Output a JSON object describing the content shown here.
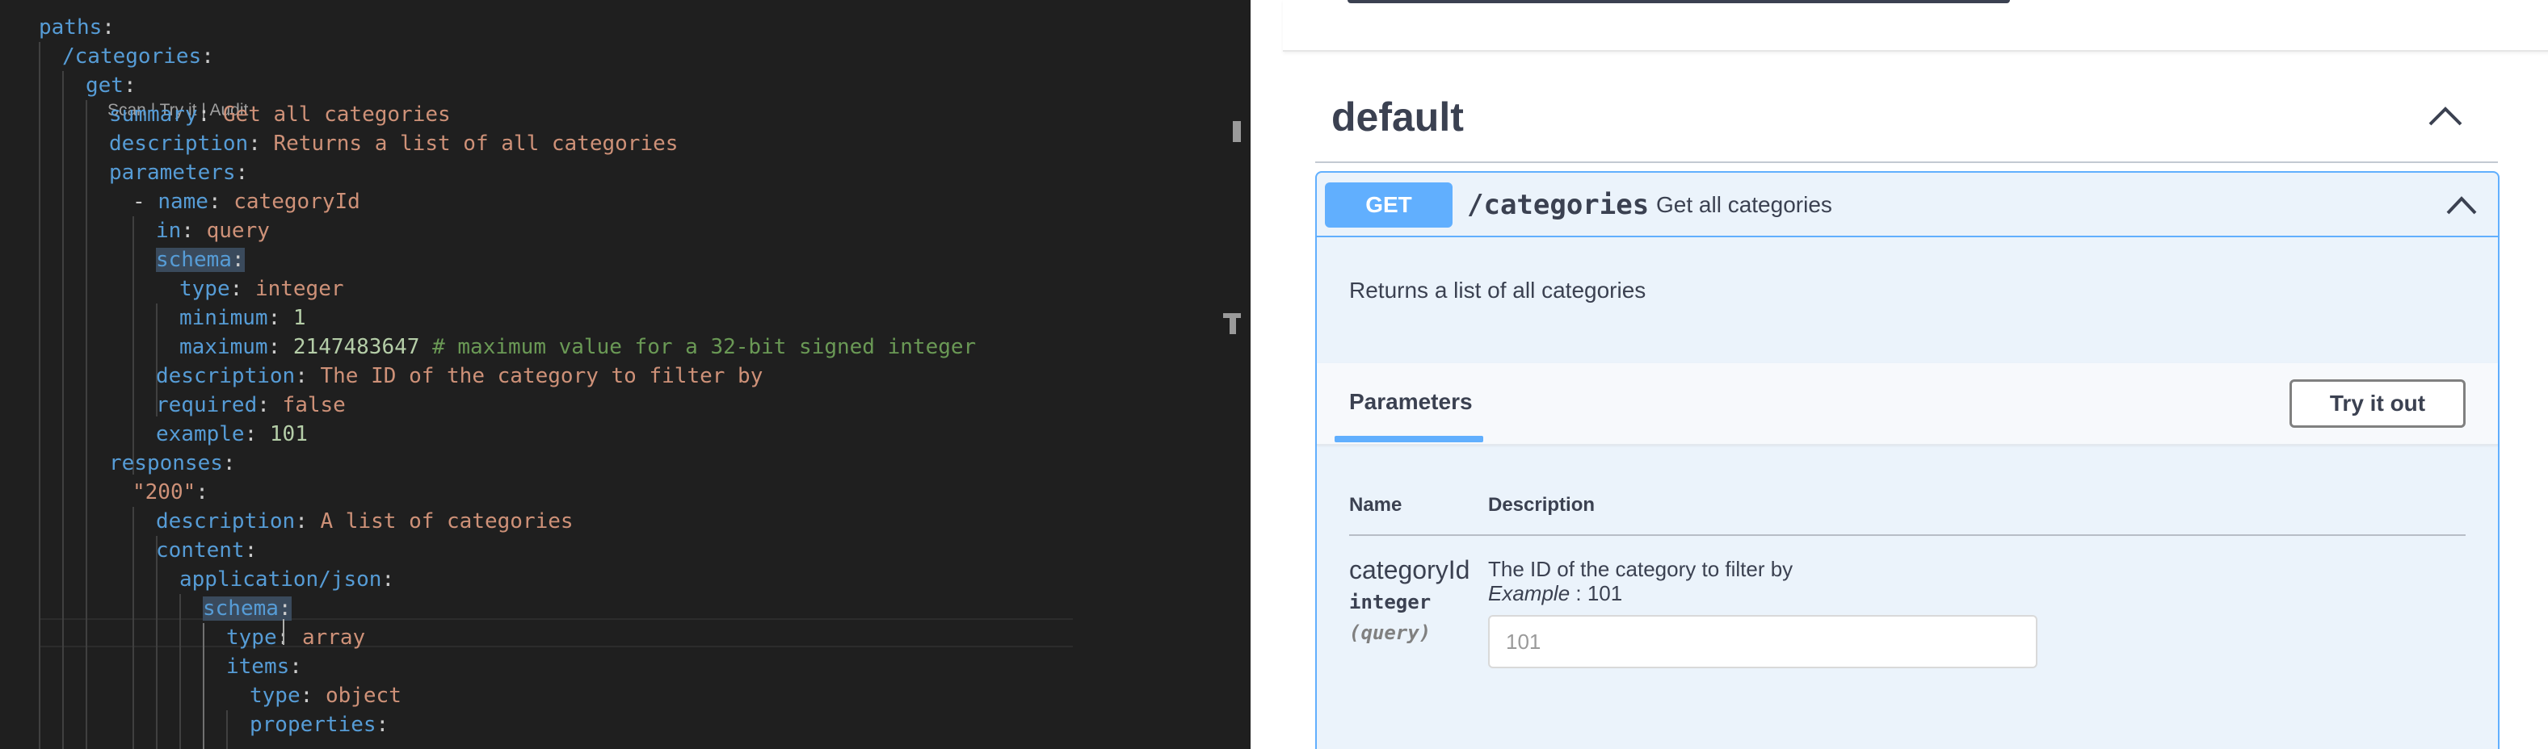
{
  "editor": {
    "codelens": "Scan | Try it | Audit",
    "lines": [
      {
        "key": "paths",
        "colon": ":"
      },
      {
        "key": "/categories",
        "colon": ":"
      },
      {
        "key": "get",
        "colon": ":"
      },
      {
        "key": "summary",
        "colon": ": ",
        "value": "Get all categories"
      },
      {
        "key": "description",
        "colon": ": ",
        "value": "Returns a list of all categories"
      },
      {
        "key": "parameters",
        "colon": ":"
      },
      {
        "dash": "- ",
        "key": "name",
        "colon": ": ",
        "value": "categoryId"
      },
      {
        "key": "in",
        "colon": ": ",
        "value": "query"
      },
      {
        "key": "schema",
        "colon": ":"
      },
      {
        "key": "type",
        "colon": ": ",
        "value": "integer"
      },
      {
        "key": "minimum",
        "colon": ": ",
        "value": "1"
      },
      {
        "key": "maximum",
        "colon": ": ",
        "value": "2147483647",
        "comment": " # maximum value for a 32-bit signed integer"
      },
      {
        "key": "description",
        "colon": ": ",
        "value": "The ID of the category to filter by"
      },
      {
        "key": "required",
        "colon": ": ",
        "value": "false"
      },
      {
        "key": "example",
        "colon": ": ",
        "value": "101"
      },
      {
        "key": "responses",
        "colon": ":"
      },
      {
        "key": "\"200\"",
        "colon": ":"
      },
      {
        "key": "description",
        "colon": ": ",
        "value": "A list of categories"
      },
      {
        "key": "content",
        "colon": ":"
      },
      {
        "key": "application/json",
        "colon": ":"
      },
      {
        "key": "schema",
        "colon": ":"
      },
      {
        "key": "type",
        "colon": ": ",
        "value": "array"
      },
      {
        "key": "items",
        "colon": ":"
      },
      {
        "key": "type",
        "colon": ": ",
        "value": "object"
      },
      {
        "key": "properties",
        "colon": ":"
      }
    ]
  },
  "preview": {
    "tag": "default",
    "operation": {
      "method": "GET",
      "path": "/categories",
      "summary": "Get all categories",
      "description": "Returns a list of all categories"
    },
    "parameters_tab": "Parameters",
    "try_it_out": "Try it out",
    "columns": {
      "name": "Name",
      "description": "Description"
    },
    "parameter": {
      "name": "categoryId",
      "type": "integer",
      "in": "(query)",
      "description": "The ID of the category to filter by",
      "example_label": "Example",
      "example_sep": " : ",
      "example_value": "101",
      "input_placeholder": "101"
    }
  },
  "colors": {
    "editor_bg": "#1f1f1f",
    "key": "#569cd6",
    "string": "#ce9178",
    "number": "#b5cea8",
    "comment": "#6a9955",
    "get_method": "#61affe",
    "opblock_bg": "#ebf3fb",
    "text": "#3b4151"
  }
}
